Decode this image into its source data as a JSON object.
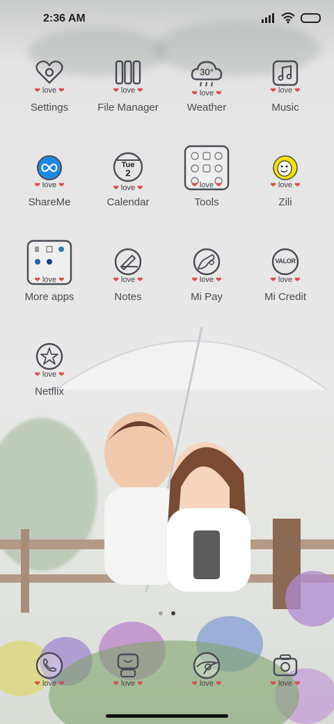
{
  "status_bar": {
    "time": "2:36 AM"
  },
  "love_text": "love",
  "heart": "❤",
  "apps": [
    {
      "name": "Settings",
      "icon": "heart-settings-icon"
    },
    {
      "name": "File Manager",
      "icon": "file-manager-icon"
    },
    {
      "name": "Weather",
      "icon": "weather-cloud-icon",
      "temp": "30°"
    },
    {
      "name": "Music",
      "icon": "music-note-icon"
    },
    {
      "name": "ShareMe",
      "icon": "shareme-infinity-icon"
    },
    {
      "name": "Calendar",
      "icon": "calendar-icon",
      "day": "Tue",
      "date": "2"
    },
    {
      "name": "Tools",
      "icon": "tools-folder-icon"
    },
    {
      "name": "Zili",
      "icon": "zili-face-icon"
    },
    {
      "name": "More apps",
      "icon": "more-apps-folder-icon"
    },
    {
      "name": "Notes",
      "icon": "notes-pen-icon"
    },
    {
      "name": "Mi Pay",
      "icon": "mi-pay-icon"
    },
    {
      "name": "Mi Credit",
      "icon": "mi-credit-icon",
      "badge": "VALOR"
    },
    {
      "name": "Netflix",
      "icon": "netflix-star-icon"
    }
  ],
  "dock": [
    {
      "icon": "phone-icon"
    },
    {
      "icon": "messaging-robot-icon"
    },
    {
      "icon": "browser-icon"
    },
    {
      "icon": "camera-icon"
    }
  ],
  "pages": {
    "count": 2,
    "active": 2
  },
  "colors": {
    "heart": "#e04848",
    "icon_stroke": "#4a4a55",
    "shareme_blue": "#1e88e5",
    "zili_yellow": "#f4e200"
  }
}
